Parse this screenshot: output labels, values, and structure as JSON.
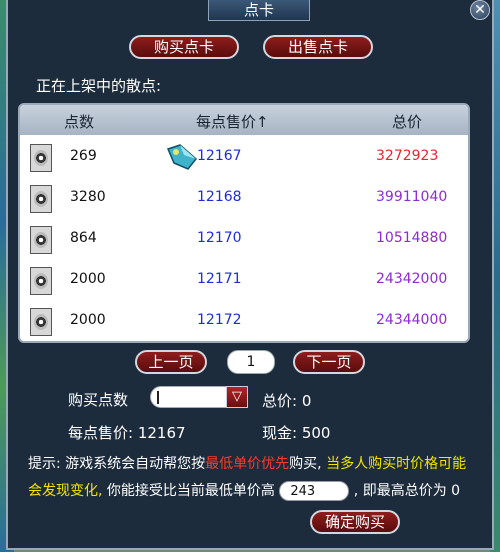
{
  "window": {
    "title": "点卡"
  },
  "tabs": {
    "buy_card": "购买点卡",
    "sell_card": "出售点卡"
  },
  "section_label": "正在上架中的散点:",
  "table": {
    "headers": [
      "点数",
      "每点售价↑",
      "总价"
    ],
    "rows": [
      {
        "points": "269",
        "unit_price": "12167",
        "total": "3272923",
        "total_color": "#e8252b"
      },
      {
        "points": "3280",
        "unit_price": "12168",
        "total": "39911040",
        "total_color": "#8e2bd1"
      },
      {
        "points": "864",
        "unit_price": "12170",
        "total": "10514880",
        "total_color": "#8e2bd1"
      },
      {
        "points": "2000",
        "unit_price": "12171",
        "total": "24342000",
        "total_color": "#8e2bd1"
      },
      {
        "points": "2000",
        "unit_price": "12172",
        "total": "24344000",
        "total_color": "#8e2bd1"
      }
    ]
  },
  "pager": {
    "prev": "上一页",
    "page": "1",
    "next": "下一页"
  },
  "buy": {
    "qty_label": "购买点数",
    "total_label": "总价: 0",
    "unit_price_label": "每点售价: 12167",
    "cash_label": "现金: 500"
  },
  "tip": {
    "p1": "提示: 游戏系统会自动帮您按",
    "p2": "最低单价优先",
    "p3": "购买, ",
    "p4": "当多人购买时价格可能会发现变化,",
    "p5": " 你能接受比当前最低单价高",
    "accept_value": "243",
    "p6": " , 即最高总价为 0"
  },
  "confirm": "确定购买"
}
